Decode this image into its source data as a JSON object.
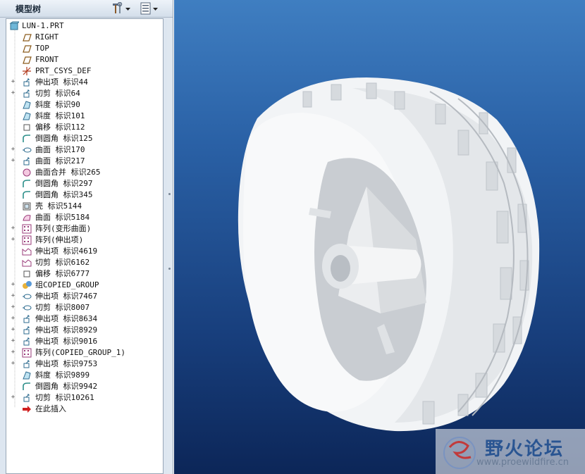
{
  "model_tree": {
    "title": "模型树",
    "items": [
      {
        "label": "LUN-1.PRT",
        "icon": "part-icon",
        "expander": false
      },
      {
        "label": "RIGHT",
        "icon": "datum-plane-icon",
        "expander": false
      },
      {
        "label": "TOP",
        "icon": "datum-plane-icon",
        "expander": false
      },
      {
        "label": "FRONT",
        "icon": "datum-plane-icon",
        "expander": false
      },
      {
        "label": "PRT_CSYS_DEF",
        "icon": "csys-icon",
        "expander": false
      },
      {
        "label": "伸出项 标识44",
        "icon": "extrude-icon",
        "expander": true
      },
      {
        "label": "切剪 标识64",
        "icon": "extrude-icon",
        "expander": true
      },
      {
        "label": "斜度 标识90",
        "icon": "draft-icon",
        "expander": false
      },
      {
        "label": "斜度 标识101",
        "icon": "draft-icon",
        "expander": false
      },
      {
        "label": "偏移 标识112",
        "icon": "offset-icon",
        "expander": false
      },
      {
        "label": "倒圆角 标识125",
        "icon": "round-icon",
        "expander": false
      },
      {
        "label": "曲面 标识170",
        "icon": "revolve-icon",
        "expander": true
      },
      {
        "label": "曲面 标识217",
        "icon": "extrude-icon",
        "expander": true
      },
      {
        "label": "曲面合并 标识265",
        "icon": "merge-icon",
        "expander": false
      },
      {
        "label": "倒圆角 标识297",
        "icon": "round-icon",
        "expander": false
      },
      {
        "label": "倒圆角 标识345",
        "icon": "round-icon",
        "expander": false
      },
      {
        "label": "壳 标识5144",
        "icon": "shell-icon",
        "expander": false
      },
      {
        "label": "曲面 标识5184",
        "icon": "surface-icon",
        "expander": false
      },
      {
        "label": "阵列(变形曲面)",
        "icon": "pattern-icon",
        "expander": true
      },
      {
        "label": "阵列(伸出项)",
        "icon": "pattern-icon",
        "expander": true
      },
      {
        "label": "伸出项 标识4619",
        "icon": "warp-icon",
        "expander": false
      },
      {
        "label": "切剪 标识6162",
        "icon": "warp-icon",
        "expander": false
      },
      {
        "label": "偏移 标识6777",
        "icon": "offset-icon",
        "expander": false
      },
      {
        "label": "组COPIED_GROUP",
        "icon": "group-icon",
        "expander": true
      },
      {
        "label": "伸出项 标识7467",
        "icon": "revolve-icon",
        "expander": true
      },
      {
        "label": "切剪 标识8007",
        "icon": "revolve-icon",
        "expander": true
      },
      {
        "label": "伸出项 标识8634",
        "icon": "extrude-icon",
        "expander": true
      },
      {
        "label": "伸出项 标识8929",
        "icon": "extrude-icon",
        "expander": true
      },
      {
        "label": "伸出项 标识9016",
        "icon": "extrude-icon",
        "expander": true
      },
      {
        "label": "阵列(COPIED_GROUP_1)",
        "icon": "pattern-icon",
        "expander": true
      },
      {
        "label": "伸出项 标识9753",
        "icon": "extrude-icon",
        "expander": true
      },
      {
        "label": "斜度 标识9899",
        "icon": "draft-icon",
        "expander": false
      },
      {
        "label": "倒圆角 标识9942",
        "icon": "round-icon",
        "expander": false
      },
      {
        "label": "切剪 标识10261",
        "icon": "extrude-icon",
        "expander": true
      },
      {
        "label": "在此插入",
        "icon": "insert-arrow-icon",
        "expander": false
      }
    ]
  },
  "watermark": {
    "name": "野火论坛",
    "url": "www.proewildfire.cn"
  },
  "colors": {
    "viewport_top": "#3f7ec1",
    "viewport_bottom": "#0c2658",
    "model": "#ffffff"
  }
}
